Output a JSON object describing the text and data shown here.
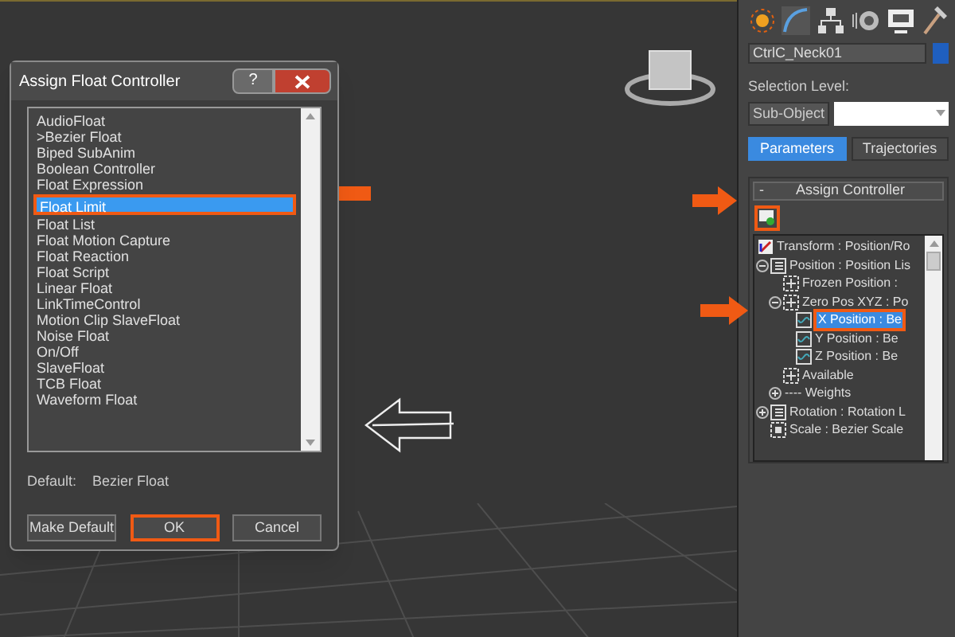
{
  "dialog": {
    "title": "Assign Float Controller",
    "help_label": "?",
    "items": [
      {
        "label": "AudioFloat",
        "selected": false
      },
      {
        "label": ">Bezier Float",
        "selected": false
      },
      {
        "label": "Biped SubAnim",
        "selected": false
      },
      {
        "label": "Boolean Controller",
        "selected": false
      },
      {
        "label": "Float Expression",
        "selected": false
      },
      {
        "label": "Float Limit",
        "selected": true,
        "highlighted": true
      },
      {
        "label": "Float List",
        "selected": false
      },
      {
        "label": "Float Motion Capture",
        "selected": false
      },
      {
        "label": "Float Reaction",
        "selected": false
      },
      {
        "label": "Float Script",
        "selected": false
      },
      {
        "label": "Linear Float",
        "selected": false
      },
      {
        "label": "LinkTimeControl",
        "selected": false
      },
      {
        "label": "Motion Clip SlaveFloat",
        "selected": false
      },
      {
        "label": "Noise Float",
        "selected": false
      },
      {
        "label": "On/Off",
        "selected": false
      },
      {
        "label": "SlaveFloat",
        "selected": false
      },
      {
        "label": "TCB Float",
        "selected": false
      },
      {
        "label": "Waveform Float",
        "selected": false
      }
    ],
    "default_label": "Default:",
    "default_value": "Bezier Float",
    "buttons": [
      {
        "label": "Make Default",
        "highlighted": false
      },
      {
        "label": "OK",
        "highlighted": true
      },
      {
        "label": "Cancel",
        "highlighted": false
      }
    ]
  },
  "panel": {
    "object_name": "CtrlC_Neck01",
    "selection_level_label": "Selection Level:",
    "sub_object_button": "Sub-Object",
    "tabs": [
      {
        "label": "Parameters",
        "selected": true
      },
      {
        "label": "Trajectories",
        "selected": false
      }
    ],
    "rollout": {
      "title": "Assign Controller",
      "collapse_sign": "-",
      "tree": [
        {
          "label": "Transform : Position/Ro",
          "kind": "transform",
          "selected": false,
          "children": [
            {
              "label": "Position : Position Lis",
              "kind": "list",
              "selected": false,
              "expanded": true,
              "children": [
                {
                  "label": "Frozen Position :",
                  "kind": "xyz",
                  "selected": false
                },
                {
                  "label": "Zero Pos XYZ : Po",
                  "kind": "xyz",
                  "selected": false,
                  "expanded": true,
                  "children": [
                    {
                      "label": "X Position : Be",
                      "kind": "curve",
                      "selected": true,
                      "highlighted": true
                    },
                    {
                      "label": "Y Position : Be",
                      "kind": "curve",
                      "selected": false
                    },
                    {
                      "label": "Z Position : Be",
                      "kind": "curve",
                      "selected": false
                    }
                  ]
                },
                {
                  "label": "Available",
                  "kind": "xyz",
                  "selected": false
                },
                {
                  "label": "---- Weights",
                  "kind": "none",
                  "selected": false,
                  "expanded": false
                }
              ]
            },
            {
              "label": "Rotation : Rotation L",
              "kind": "list",
              "selected": false,
              "expanded": false
            },
            {
              "label": "Scale : Bezier Scale",
              "kind": "scale",
              "selected": false
            }
          ]
        }
      ]
    }
  }
}
